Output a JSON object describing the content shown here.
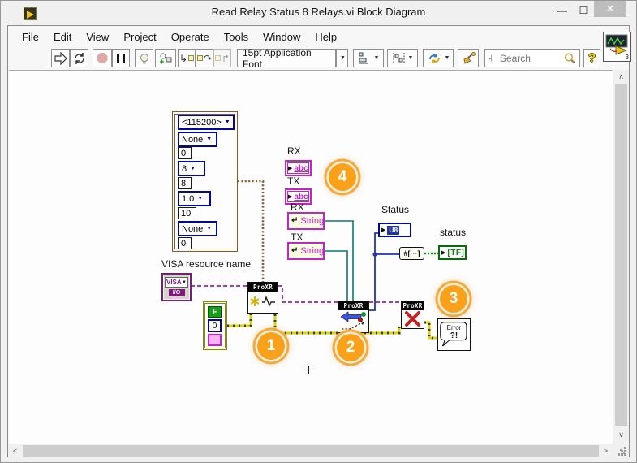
{
  "titlebar": {
    "title": "Read Relay Status 8 Relays.vi Block Diagram",
    "buttons": {
      "minimize": "—",
      "maximize": "☐",
      "close": "✕"
    }
  },
  "menu": {
    "items": [
      "File",
      "Edit",
      "View",
      "Project",
      "Operate",
      "Tools",
      "Window",
      "Help"
    ]
  },
  "toolbar": {
    "font_selector": "15pt Application Font",
    "search_placeholder": "Search",
    "help_glyph": "?",
    "logo_badge": "3"
  },
  "diagram": {
    "cluster": {
      "items": [
        {
          "value": "<115200>",
          "kind": "ring"
        },
        {
          "value": "None",
          "kind": "ring"
        },
        {
          "value": "0",
          "kind": "numeric"
        },
        {
          "value": "8",
          "kind": "ring"
        },
        {
          "value": "8",
          "kind": "numeric"
        },
        {
          "value": "1.0",
          "kind": "ring"
        },
        {
          "value": "10",
          "kind": "numeric"
        },
        {
          "value": "None",
          "kind": "ring"
        },
        {
          "value": "0",
          "kind": "numeric"
        }
      ]
    },
    "visa": {
      "label": "VISA resource name",
      "text": "VISA",
      "io": "I/O"
    },
    "error_constant": {
      "status": "F",
      "code": "0"
    },
    "node_header": "ProXR",
    "labels": {
      "rx": "RX",
      "tx": "TX",
      "status_u8": "Status",
      "status_bool": "status"
    },
    "terminals": {
      "string_icon": "abc",
      "string_local": "String",
      "u8": "U8",
      "bool_array": "[TF]",
      "converter": "#[···]"
    },
    "error_handler": {
      "line1": "Error",
      "line2": "?!"
    },
    "annotations": [
      "1",
      "2",
      "3",
      "4"
    ]
  },
  "colors": {
    "accent_orange": "#F9A11B",
    "wire_error_yellow": "#DFD400",
    "wire_visa_purple": "#A21CA2",
    "wire_string_teal": "#0B7777",
    "wire_numeric_blue": "#1F35B4",
    "wire_bool_green": "#00A000",
    "wire_cluster_brown": "#8A5A2A",
    "terminal_magenta": "#C424C4",
    "terminal_navy": "#000A8C",
    "terminal_green": "#0A6B0A"
  }
}
